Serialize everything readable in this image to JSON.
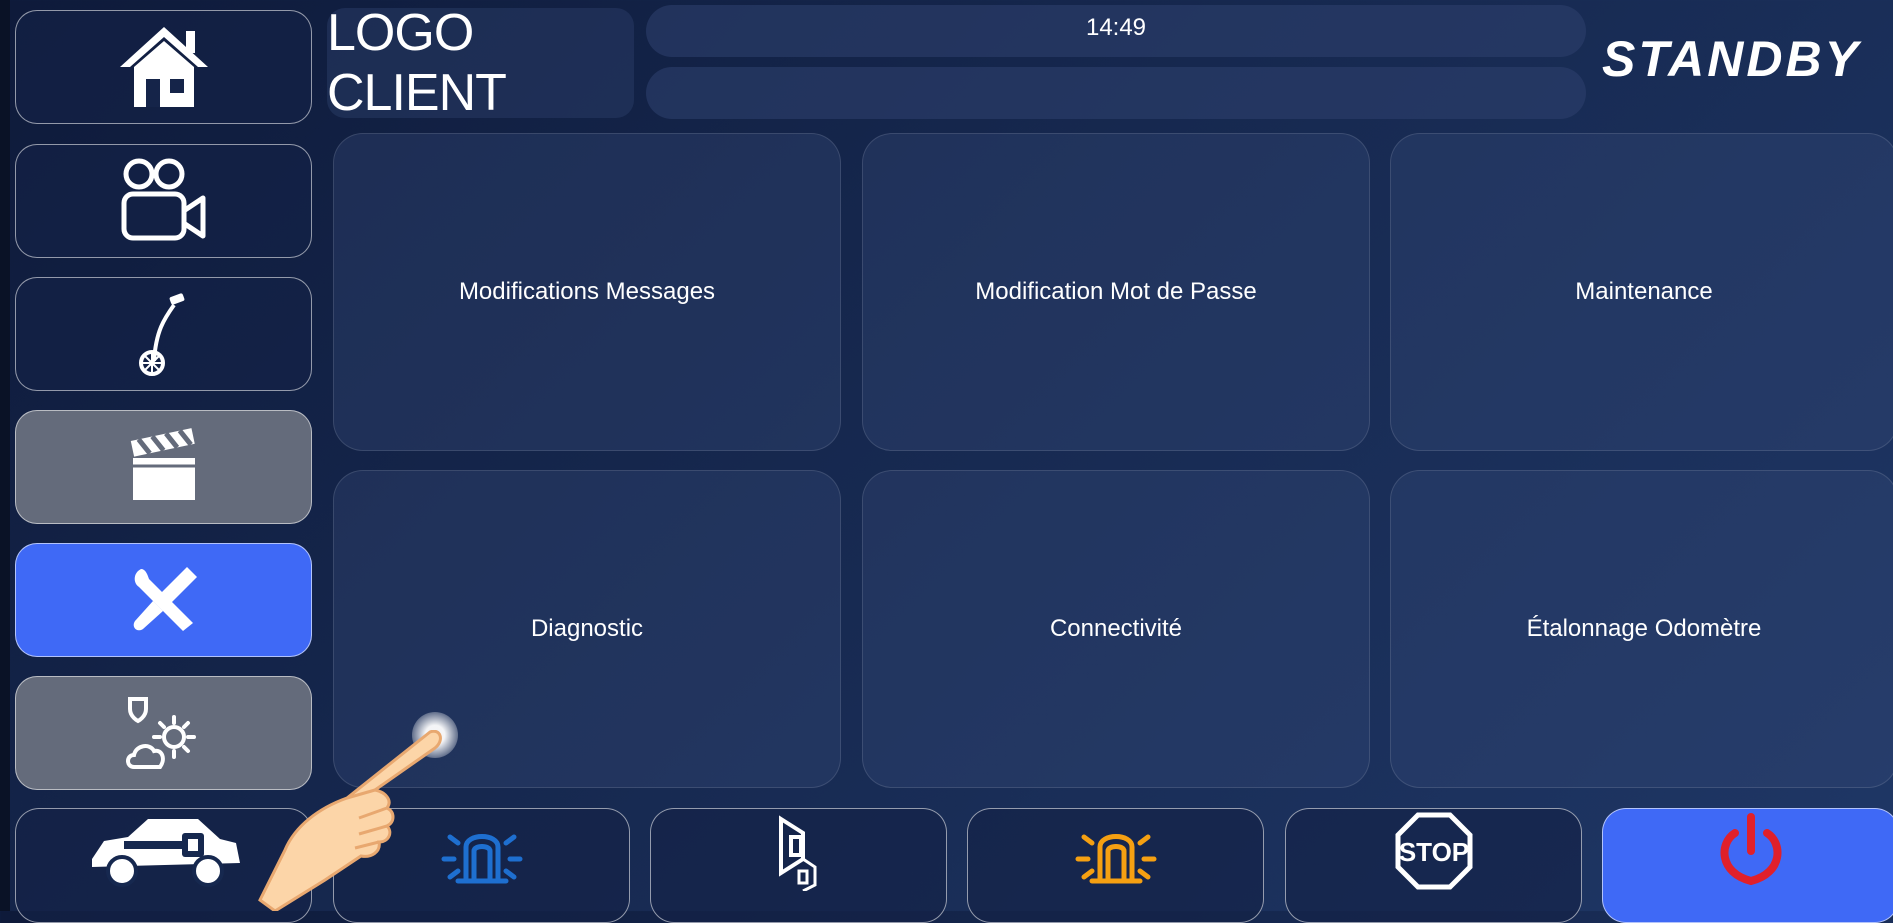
{
  "header": {
    "logo_client": "LOGO CLIENT",
    "clock": "14:49",
    "brand": "STANDBY"
  },
  "sidebar": {
    "items": [
      {
        "icon": "home-icon",
        "state": "default"
      },
      {
        "icon": "video-camera-icon",
        "state": "default"
      },
      {
        "icon": "measuring-wheel-icon",
        "state": "default"
      },
      {
        "icon": "clapperboard-icon",
        "state": "disabled"
      },
      {
        "icon": "tools-icon",
        "state": "active"
      },
      {
        "icon": "weather-icon",
        "state": "disabled"
      }
    ]
  },
  "main": {
    "tiles": [
      {
        "label": "Modifications Messages"
      },
      {
        "label": "Modification Mot de Passe"
      },
      {
        "label": "Maintenance"
      },
      {
        "label": "Diagnostic"
      },
      {
        "label": "Connectivité"
      },
      {
        "label": "Étalonnage Odomètre"
      }
    ]
  },
  "bottom_bar": {
    "buttons": [
      {
        "icon": "car-key-icon"
      },
      {
        "icon": "blue-beacon-icon"
      },
      {
        "icon": "horn-icon"
      },
      {
        "icon": "orange-beacon-icon"
      },
      {
        "icon": "stop-sign-icon",
        "text": "STOP"
      },
      {
        "icon": "power-icon"
      }
    ]
  },
  "colors": {
    "accent_blue": "#3f69f6",
    "disabled_gray": "#646b7b",
    "beacon_blue": "#1e6fd0",
    "beacon_orange": "#f5a012",
    "power_red": "#e0202a"
  }
}
